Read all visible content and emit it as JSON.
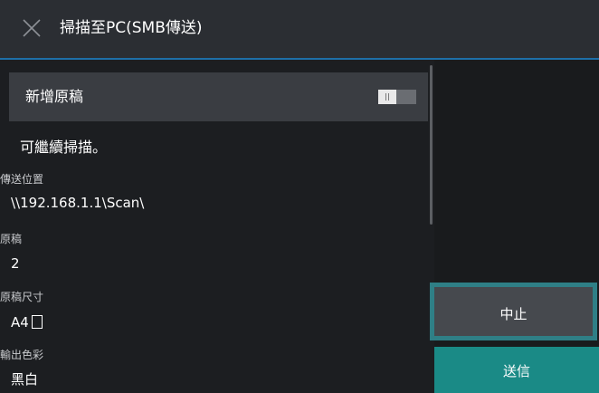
{
  "header": {
    "title": "掃描至PC(SMB傳送)",
    "close_icon": "close-icon"
  },
  "add_original": {
    "label": "新增原稿",
    "toggle_state": "off"
  },
  "note": "可繼續掃描。",
  "fields": [
    {
      "label": "傳送位置",
      "value": "\\\\192.168.1.1\\Scan\\"
    },
    {
      "label": "原稿",
      "value": "2"
    },
    {
      "label": "原稿尺寸",
      "value": "A4"
    },
    {
      "label": "輸出色彩",
      "value": "黑白"
    }
  ],
  "actions": {
    "stop_label": "中止",
    "send_label": "送信"
  },
  "colors": {
    "accent": "#1e6fa8",
    "send": "#1a8a86",
    "focus_ring": "#2f7f86"
  }
}
